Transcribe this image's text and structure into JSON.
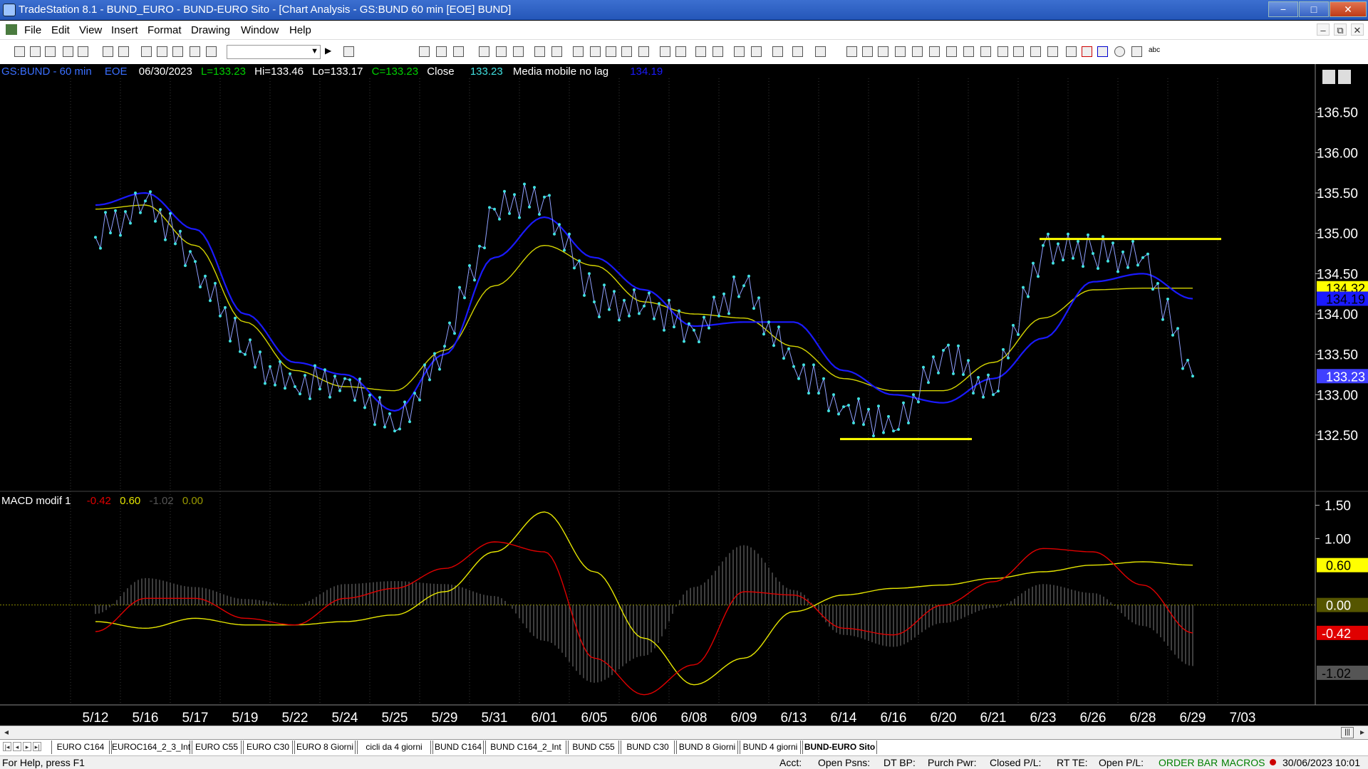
{
  "window": {
    "title": "TradeStation 8.1 - BUND_EURO - BUND-EURO Sito - [Chart Analysis - GS:BUND  60 min  [EOE] BUND]",
    "minimize": "−",
    "maximize": "□",
    "close": "✕"
  },
  "menu": [
    "File",
    "Edit",
    "View",
    "Insert",
    "Format",
    "Drawing",
    "Window",
    "Help"
  ],
  "mdi_controls": [
    "–",
    "⧉",
    "✕"
  ],
  "toolbar": {
    "symbol_value": ""
  },
  "chart": {
    "header": {
      "symbol": "GS:BUND - 60 min",
      "exchange": "EOE",
      "date": "06/30/2023",
      "last": "L=133.23",
      "high": "Hi=133.46",
      "low": "Lo=133.17",
      "close": "C=133.23",
      "close_label": "Close",
      "close_value": "133.23",
      "indicator_name": "Media mobile no lag",
      "indicator_value": "134.19"
    },
    "macd_header": {
      "name": "MACD modif 1",
      "v1": "-0.42",
      "v2": "0.60",
      "v3": "-1.02",
      "v4": "0.00"
    },
    "colors": {
      "background": "#000000",
      "price": "#40e0e0",
      "ma_blue": "#1a1aff",
      "ma_yellow": "#d4d400",
      "macd_red": "#e00000",
      "macd_yellow": "#e6e600",
      "histogram": "#7a7a7a",
      "support_resistance": "#ffff00"
    },
    "price_ticks": [
      "136.50",
      "136.00",
      "135.50",
      "135.00",
      "134.50",
      "134.00",
      "133.50",
      "133.00",
      "132.50"
    ],
    "price_badges": [
      {
        "value": "134.32",
        "bg": "#ffff00",
        "fg": "#000000"
      },
      {
        "value": "134.19",
        "bg": "#1a1aff",
        "fg": "#000000"
      },
      {
        "value": "133.23",
        "bg": "#4040ff",
        "fg": "#ffffff"
      }
    ],
    "macd_ticks": [
      "1.50",
      "1.00"
    ],
    "macd_badges": [
      {
        "value": "0.60",
        "bg": "#ffff00",
        "fg": "#000000"
      },
      {
        "value": "0.00",
        "bg": "#555500",
        "fg": "#ffffff"
      },
      {
        "value": "-0.42",
        "bg": "#e00000",
        "fg": "#ffffff"
      },
      {
        "value": "-1.02",
        "bg": "#555555",
        "fg": "#000000"
      }
    ],
    "date_labels": [
      "5/12",
      "5/16",
      "5/17",
      "5/19",
      "5/22",
      "5/24",
      "5/25",
      "5/29",
      "5/31",
      "6/01",
      "6/05",
      "6/06",
      "6/08",
      "6/09",
      "6/13",
      "6/14",
      "6/16",
      "6/20",
      "6/21",
      "6/23",
      "6/26",
      "6/28",
      "6/29",
      "7/03"
    ],
    "chart_data": {
      "type": "line",
      "xlabel": "",
      "ylabel": "",
      "ylim": [
        132.2,
        136.7
      ],
      "x": [
        "5/12",
        "5/16",
        "5/17",
        "5/19",
        "5/22",
        "5/24",
        "5/25",
        "5/29",
        "5/31",
        "6/01",
        "6/05",
        "6/06",
        "6/08",
        "6/09",
        "6/13",
        "6/14",
        "6/16",
        "6/20",
        "6/21",
        "6/23",
        "6/26",
        "6/28",
        "6/29"
      ],
      "series": [
        {
          "name": "",
          "values": [
            134.95,
            135.4,
            134.65,
            133.5,
            133.1,
            133.2,
            132.55,
            133.6,
            135.3,
            135.45,
            134.15,
            134.1,
            133.8,
            134.35,
            133.35,
            132.85,
            132.55,
            133.55,
            133.0,
            134.85,
            134.75,
            134.7,
            133.23
          ]
        },
        {
          "name": "",
          "values": [
            135.35,
            135.5,
            135.05,
            134.0,
            133.4,
            133.25,
            132.8,
            133.5,
            134.7,
            135.2,
            134.7,
            134.3,
            133.85,
            133.9,
            133.9,
            133.3,
            133.0,
            132.9,
            133.2,
            133.7,
            134.4,
            134.5,
            134.19
          ]
        },
        {
          "name": "",
          "values": [
            135.3,
            135.35,
            134.85,
            133.9,
            133.3,
            133.1,
            133.05,
            133.55,
            134.35,
            134.85,
            134.6,
            134.15,
            134.0,
            133.95,
            133.6,
            133.2,
            133.05,
            133.05,
            133.4,
            133.95,
            134.3,
            134.32,
            134.32
          ]
        }
      ],
      "annotations": [
        {
          "type": "horizontal",
          "value": 134.93,
          "from": "6/23",
          "to": "7/03"
        },
        {
          "type": "horizontal",
          "value": 132.45,
          "from": "6/14",
          "to": "6/21"
        }
      ],
      "macd": {
        "ylim": [
          -1.45,
          1.55
        ],
        "series": [
          {
            "name": "",
            "values": [
              -0.4,
              0.1,
              0.1,
              -0.2,
              -0.3,
              0.1,
              0.25,
              0.55,
              0.95,
              0.8,
              -0.8,
              -1.35,
              -0.9,
              0.2,
              0.15,
              -0.35,
              -0.45,
              0.0,
              0.35,
              0.85,
              0.8,
              0.3,
              -0.42
            ]
          },
          {
            "name": "",
            "values": [
              -0.25,
              -0.35,
              -0.2,
              -0.3,
              -0.3,
              -0.25,
              -0.15,
              0.2,
              0.8,
              1.4,
              0.5,
              -0.5,
              -1.2,
              -0.8,
              -0.1,
              0.15,
              0.25,
              0.3,
              0.4,
              0.5,
              0.6,
              0.65,
              0.6
            ]
          }
        ],
        "zero_line": 0.0
      }
    }
  },
  "scrollbar": {
    "left": "◂",
    "right": "▸"
  },
  "tabs": [
    {
      "label": "EURO C164",
      "active": false
    },
    {
      "label": "EUROC164_2_3_Int",
      "active": false
    },
    {
      "label": "EURO C55",
      "active": false
    },
    {
      "label": "EURO C30",
      "active": false
    },
    {
      "label": "EURO 8 Giorni",
      "active": false
    },
    {
      "label": "cicli da 4 giorni",
      "active": false
    },
    {
      "label": "BUND C164",
      "active": false
    },
    {
      "label": "BUND C164_2_Int",
      "active": false
    },
    {
      "label": "BUND C55",
      "active": false
    },
    {
      "label": "BUND  C30",
      "active": false
    },
    {
      "label": "BUND 8 Giorni",
      "active": false
    },
    {
      "label": "BUND 4 giorni",
      "active": false
    },
    {
      "label": "BUND-EURO Sito",
      "active": true
    }
  ],
  "status": {
    "help": "For Help, press F1",
    "acct": "Acct:",
    "open_psns": "Open Psns:",
    "dt_bp": "DT BP:",
    "purch_pwr": "Purch Pwr:",
    "closed_pl": "Closed P/L:",
    "rt_te": "RT TE:",
    "open_pl": "Open P/L:",
    "order_bar": "ORDER BAR",
    "macros": "MACROS",
    "datetime": "30/06/2023 10:01"
  }
}
